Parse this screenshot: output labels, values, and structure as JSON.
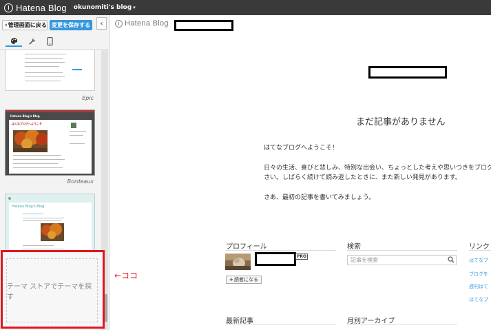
{
  "topbar": {
    "brand": "Hatena Blog",
    "blog_name": "okunomiti's blog",
    "caret": "▾"
  },
  "sidebar": {
    "back_label": "管理画面に戻る",
    "save_label": "変更を保存する",
    "collapse_glyph": "‹",
    "themes": [
      {
        "name": "Epic"
      },
      {
        "name": "Bordeaux",
        "mini_title": "Hatena Blog's Blog",
        "mini_heading": "はてなブログへようこそ"
      },
      {
        "name": "",
        "mini_title": "Hatena Blog's Blog"
      }
    ],
    "store_label": "テーマ ストアでテーマを探す"
  },
  "annotation": "←ココ",
  "preview": {
    "brand": "Hatena Blog",
    "no_posts": "まだ記事がありません",
    "welcome": [
      "はてなブログへようこそ！",
      "日々の生活、喜びと悲しみ、特別な出会い、ちょっとした考えや思いつきをブログ",
      "さい。しばらく続けて読み返したときに、また新しい発見があります。",
      "さあ、最初の記事を書いてみましょう。"
    ],
    "profile_title": "プロフィール",
    "pro_badge": "PRO",
    "follow_label": "読者になる",
    "search_title": "検索",
    "search_placeholder": "記事を検索",
    "links_title": "リンク",
    "links": [
      "はてなブ",
      "ブログを",
      "週刊はて",
      "はてなブ"
    ],
    "recent_title": "最新記事",
    "archive_title": "月別アーカイブ"
  },
  "colors": {
    "accent": "#3598dc",
    "annotation": "#e0161c",
    "topbar": "#3a3a3a"
  }
}
